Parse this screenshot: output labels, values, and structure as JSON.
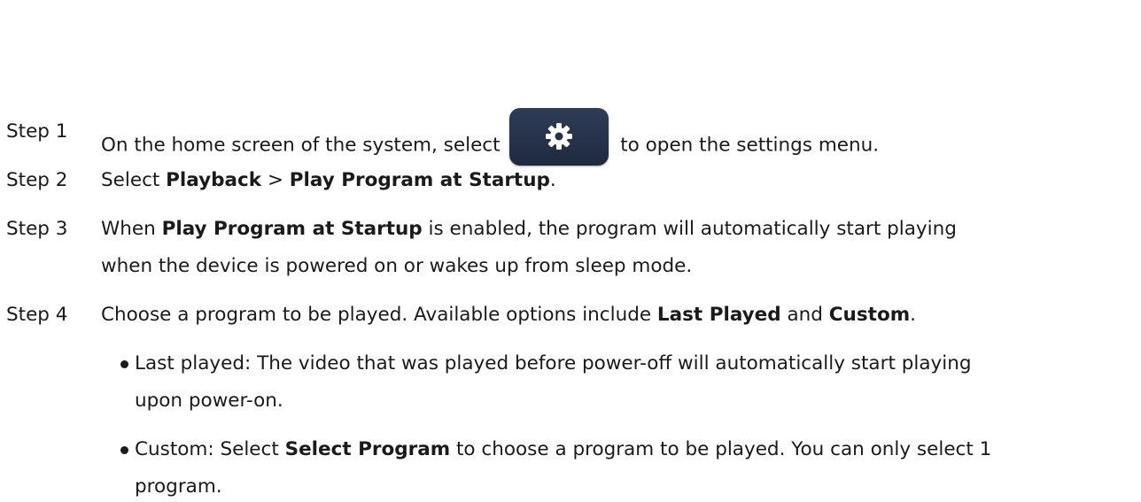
{
  "steps": [
    {
      "label": "Step 1",
      "parts": [
        "On the home screen of the system, select",
        "to open the settings menu."
      ],
      "icon": "gear-icon"
    },
    {
      "label": "Step 2",
      "parts": [
        "Select ",
        "Playback",
        " > ",
        "Play Program at Startup",
        "."
      ]
    },
    {
      "label": "Step 3",
      "parts": [
        "When ",
        "Play Program at Startup",
        " is enabled, the program will automatically start playing",
        "when the device is powered on or wakes up from sleep mode."
      ]
    },
    {
      "label": "Step 4",
      "parts": [
        "Choose a program to be played. Available options include ",
        "Last Played",
        " and ",
        "Custom",
        "."
      ]
    }
  ],
  "bullets": [
    {
      "lines": [
        "Last played: The video that was played before power-off will automatically start playing",
        "upon power-on."
      ]
    },
    {
      "parts": [
        "Custom: Select ",
        "Select Program",
        " to choose a program to be played. You can only select 1",
        "program."
      ]
    }
  ],
  "colors": {
    "text": "#1a1a1a",
    "button_bg": "#26324a",
    "icon": "#ffffff"
  }
}
